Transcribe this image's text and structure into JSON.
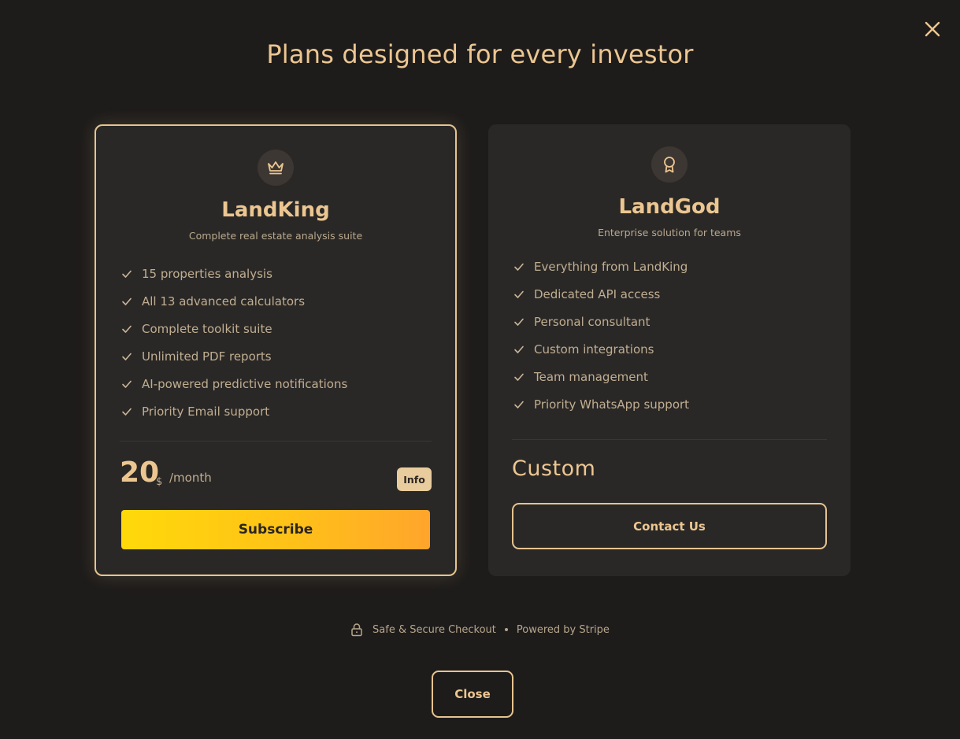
{
  "title": "Plans designed for every investor",
  "close_icon": "close-x-icon",
  "colors": {
    "accent": "#ecc691",
    "border_accent": "#e6c48f",
    "background": "#1e1c1b",
    "card": "#2a2826",
    "subscribe_gradient_start": "#ffd90a",
    "subscribe_gradient_end": "#ffa52b"
  },
  "plans": [
    {
      "icon": "crown-icon",
      "name": "LandKing",
      "subtitle": "Complete real estate analysis suite",
      "features": [
        "15 properties analysis",
        "All 13 advanced calculators",
        "Complete toolkit suite",
        "Unlimited PDF reports",
        "AI-powered predictive notifications",
        "Priority Email support"
      ],
      "price": "20",
      "currency": "$",
      "period": "/month",
      "info_label": "Info",
      "cta": "Subscribe"
    },
    {
      "icon": "award-ribbon-icon",
      "name": "LandGod",
      "subtitle": "Enterprise solution for teams",
      "features": [
        "Everything from LandKing",
        "Dedicated API access",
        "Personal consultant",
        "Custom integrations",
        "Team management",
        "Priority WhatsApp support"
      ],
      "price_label": "Custom",
      "cta": "Contact Us"
    }
  ],
  "footer": {
    "lock_icon": "lock-icon",
    "secure_text": "Safe & Secure Checkout",
    "powered_text": "Powered by Stripe"
  },
  "close_label": "Close"
}
